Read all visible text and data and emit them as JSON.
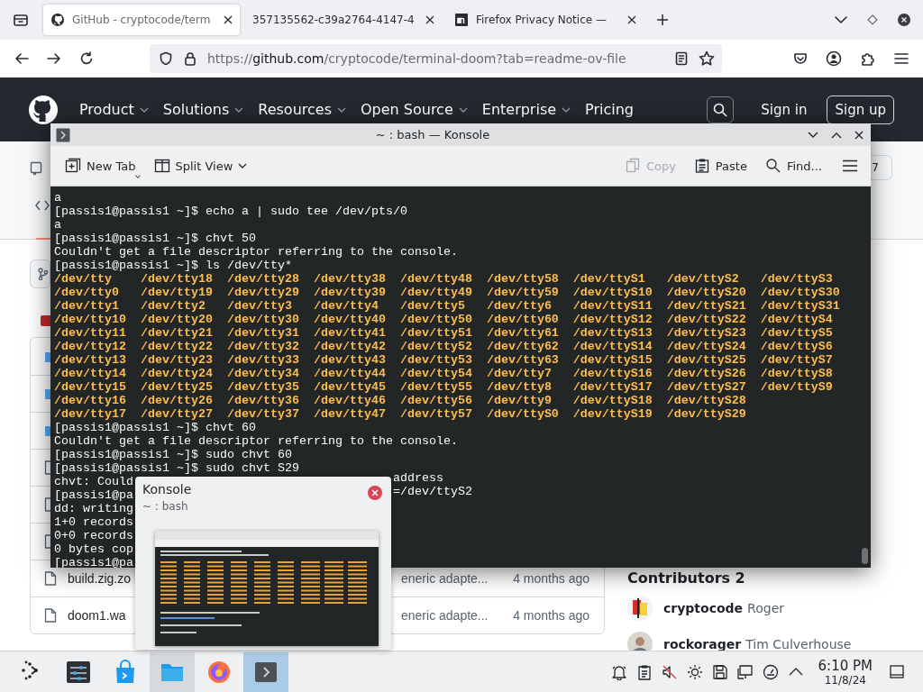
{
  "browser": {
    "tabs": [
      {
        "title": "GitHub - cryptocode/term",
        "selected": true
      },
      {
        "title": "357135562-c39a2764-4147-4",
        "selected": false
      },
      {
        "title": "Firefox Privacy Notice — ",
        "selected": false
      }
    ],
    "url": "https://**github.com**/cryptocode/terminal-doom?tab=readme-ov-file"
  },
  "github": {
    "nav": [
      {
        "label": "Product",
        "dropdown": true
      },
      {
        "label": "Solutions",
        "dropdown": true
      },
      {
        "label": "Resources",
        "dropdown": true
      },
      {
        "label": "Open Source",
        "dropdown": true
      },
      {
        "label": "Enterprise",
        "dropdown": true
      },
      {
        "label": "Pricing",
        "dropdown": false
      }
    ],
    "sign_in": "Sign in",
    "sign_up": "Sign up",
    "star_count": "7",
    "files": [
      {
        "kind": "folder"
      },
      {
        "kind": "folder"
      },
      {
        "kind": "folder"
      },
      {
        "kind": "file"
      },
      {
        "kind": "file"
      },
      {
        "kind": "file"
      },
      {
        "kind": "file",
        "name": "build.zig.zo",
        "message": "eneric adapte...",
        "age": "4 months ago"
      },
      {
        "kind": "file",
        "name": "doom1.wa",
        "message": "eneric adapte...",
        "age": "4 months ago"
      }
    ],
    "contributors_heading": "Contributors 2",
    "contributors": [
      {
        "login": "cryptocode",
        "name": "Roger"
      },
      {
        "login": "rockorager",
        "name": "Tim Culverhouse"
      }
    ]
  },
  "konsole": {
    "title": "~ : bash — Konsole",
    "toolbar": [
      {
        "label": "New Tab",
        "disabled": false
      },
      {
        "label": "Split View",
        "disabled": false
      },
      {
        "label": "Copy",
        "disabled": true
      },
      {
        "label": "Paste",
        "disabled": false
      },
      {
        "label": "Find...",
        "disabled": false
      }
    ],
    "lines": [
      {
        "kind": "text",
        "text": "a"
      },
      {
        "kind": "text",
        "text": "[passis1@passis1 ~]$ echo a | sudo tee /dev/pts/0"
      },
      {
        "kind": "text",
        "text": "a"
      },
      {
        "kind": "text",
        "text": "[passis1@passis1 ~]$ chvt 50"
      },
      {
        "kind": "text",
        "text": "Couldn't get a file descriptor referring to the console."
      },
      {
        "kind": "text",
        "text": "[passis1@passis1 ~]$ ls /dev/tty*"
      },
      {
        "kind": "listing",
        "entries": [
          "/dev/tty",
          "/dev/tty18",
          "/dev/tty28",
          "/dev/tty38",
          "/dev/tty48",
          "/dev/tty58",
          "/dev/ttyS1",
          "/dev/ttyS2",
          "/dev/ttyS3"
        ]
      },
      {
        "kind": "listing",
        "entries": [
          "/dev/tty0",
          "/dev/tty19",
          "/dev/tty29",
          "/dev/tty39",
          "/dev/tty49",
          "/dev/tty59",
          "/dev/ttyS10",
          "/dev/ttyS20",
          "/dev/ttyS30"
        ]
      },
      {
        "kind": "listing",
        "entries": [
          "/dev/tty1",
          "/dev/tty2",
          "/dev/tty3",
          "/dev/tty4",
          "/dev/tty5",
          "/dev/tty6",
          "/dev/ttyS11",
          "/dev/ttyS21",
          "/dev/ttyS31"
        ]
      },
      {
        "kind": "listing",
        "entries": [
          "/dev/tty10",
          "/dev/tty20",
          "/dev/tty30",
          "/dev/tty40",
          "/dev/tty50",
          "/dev/tty60",
          "/dev/ttyS12",
          "/dev/ttyS22",
          "/dev/ttyS4"
        ]
      },
      {
        "kind": "listing",
        "entries": [
          "/dev/tty11",
          "/dev/tty21",
          "/dev/tty31",
          "/dev/tty41",
          "/dev/tty51",
          "/dev/tty61",
          "/dev/ttyS13",
          "/dev/ttyS23",
          "/dev/ttyS5"
        ]
      },
      {
        "kind": "listing",
        "entries": [
          "/dev/tty12",
          "/dev/tty22",
          "/dev/tty32",
          "/dev/tty42",
          "/dev/tty52",
          "/dev/tty62",
          "/dev/ttyS14",
          "/dev/ttyS24",
          "/dev/ttyS6"
        ]
      },
      {
        "kind": "listing",
        "entries": [
          "/dev/tty13",
          "/dev/tty23",
          "/dev/tty33",
          "/dev/tty43",
          "/dev/tty53",
          "/dev/tty63",
          "/dev/ttyS15",
          "/dev/ttyS25",
          "/dev/ttyS7"
        ]
      },
      {
        "kind": "listing",
        "entries": [
          "/dev/tty14",
          "/dev/tty24",
          "/dev/tty34",
          "/dev/tty44",
          "/dev/tty54",
          "/dev/tty7",
          "/dev/ttyS16",
          "/dev/ttyS26",
          "/dev/ttyS8"
        ]
      },
      {
        "kind": "listing",
        "entries": [
          "/dev/tty15",
          "/dev/tty25",
          "/dev/tty35",
          "/dev/tty45",
          "/dev/tty55",
          "/dev/tty8",
          "/dev/ttyS17",
          "/dev/ttyS27",
          "/dev/ttyS9"
        ]
      },
      {
        "kind": "listing",
        "entries": [
          "/dev/tty16",
          "/dev/tty26",
          "/dev/tty36",
          "/dev/tty46",
          "/dev/tty56",
          "/dev/tty9",
          "/dev/ttyS18",
          "/dev/ttyS28"
        ]
      },
      {
        "kind": "listing",
        "entries": [
          "/dev/tty17",
          "/dev/tty27",
          "/dev/tty37",
          "/dev/tty47",
          "/dev/tty57",
          "/dev/ttyS0",
          "/dev/ttyS19",
          "/dev/ttyS29"
        ]
      },
      {
        "kind": "text",
        "text": "[passis1@passis1 ~]$ chvt 60"
      },
      {
        "kind": "text",
        "text": "Couldn't get a file descriptor referring to the console."
      },
      {
        "kind": "text",
        "text": "[passis1@passis1 ~]$ sudo chvt 60"
      },
      {
        "kind": "text",
        "text": "[passis1@passis1 ~]$ sudo chvt S29"
      },
      {
        "kind": "text",
        "text": "chvt: Could",
        "tail": "address"
      },
      {
        "kind": "text",
        "text": "[passis1@pa",
        "tail": "=/dev/ttyS2"
      },
      {
        "kind": "text",
        "text": "dd: writing"
      },
      {
        "kind": "text",
        "text": "1+0 records"
      },
      {
        "kind": "text",
        "text": "0+0 records"
      },
      {
        "kind": "text",
        "text": "0 bytes cop"
      },
      {
        "kind": "text",
        "text": "[passis1@pa"
      }
    ]
  },
  "preview": {
    "title": "Konsole",
    "subtitle": "~ : bash"
  },
  "taskbar": {
    "tasks": [
      {
        "highlighted": false,
        "selected": false
      },
      {
        "highlighted": false,
        "selected": false
      },
      {
        "highlighted": false,
        "selected": false
      },
      {
        "highlighted": true,
        "selected": false
      },
      {
        "highlighted": false,
        "selected": false
      },
      {
        "highlighted": true,
        "selected": true
      }
    ],
    "time": "6:10 PM",
    "date": "11/8/24"
  }
}
